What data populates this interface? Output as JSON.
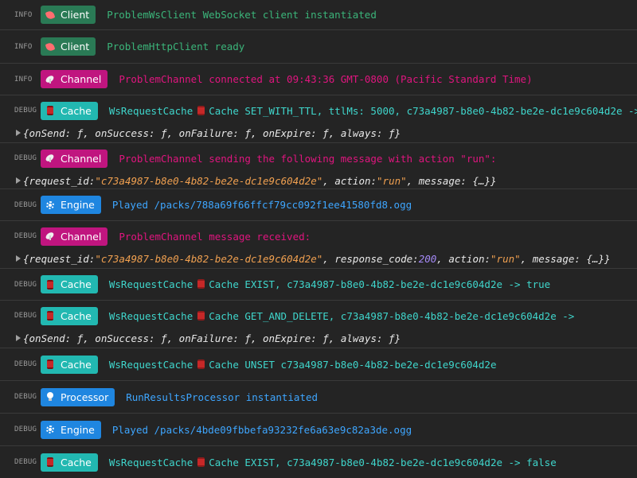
{
  "colors": {
    "background": "#242424",
    "client": "#2a7a55",
    "channel": "#c0157f",
    "cache": "#22b8b1",
    "engine": "#1f86e0",
    "processor": "#1f86e0"
  },
  "entries": [
    {
      "level": "INFO",
      "badge": {
        "label": "Client",
        "icon": "telephone-icon"
      },
      "message": "ProblemWsClient WebSocket client instantiated"
    },
    {
      "level": "INFO",
      "badge": {
        "label": "Client",
        "icon": "telephone-icon"
      },
      "message": "ProblemHttpClient ready"
    },
    {
      "level": "INFO",
      "badge": {
        "label": "Channel",
        "icon": "satellite-dish-icon"
      },
      "message": "ProblemChannel connected at 09:43:36 GMT-0800 (Pacific Standard Time)"
    },
    {
      "level": "DEBUG",
      "badge": {
        "label": "Cache",
        "icon": "cache-can-icon"
      },
      "message_pre": "WsRequestCache",
      "message_post": "Cache SET_WITH_TTL, ttlMs: 5000, c73a4987-b8e0-4b82-be2e-dc1e9c604d2e ->",
      "object": "{onSend: ƒ, onSuccess: ƒ, onFailure: ƒ, onExpire: ƒ, always: ƒ}"
    },
    {
      "level": "DEBUG",
      "badge": {
        "label": "Channel",
        "icon": "satellite-dish-icon"
      },
      "message": "ProblemChannel sending the following message with action \"run\":",
      "object_parts": {
        "k1": "{request_id: ",
        "v1": "\"c73a4987-b8e0-4b82-be2e-dc1e9c604d2e\"",
        "k2": ", action: ",
        "v2": "\"run\"",
        "k3": ", message: {…}}"
      }
    },
    {
      "level": "DEBUG",
      "badge": {
        "label": "Engine",
        "icon": "gear-icon"
      },
      "message": "Played /packs/788a69f66ffcf79cc092f1ee41580fd8.ogg"
    },
    {
      "level": "DEBUG",
      "badge": {
        "label": "Channel",
        "icon": "satellite-dish-icon"
      },
      "message": "ProblemChannel message received:",
      "object_parts": {
        "k1": "{request_id: ",
        "v1": "\"c73a4987-b8e0-4b82-be2e-dc1e9c604d2e\"",
        "k2": ", response_code: ",
        "n1": "200",
        "k3": ", action: ",
        "v2": "\"run\"",
        "k4": ", message: {…}}"
      }
    },
    {
      "level": "DEBUG",
      "badge": {
        "label": "Cache",
        "icon": "cache-can-icon"
      },
      "message_pre": "WsRequestCache",
      "message_post": "Cache EXIST, c73a4987-b8e0-4b82-be2e-dc1e9c604d2e -> true"
    },
    {
      "level": "DEBUG",
      "badge": {
        "label": "Cache",
        "icon": "cache-can-icon"
      },
      "message_pre": "WsRequestCache",
      "message_post": "Cache GET_AND_DELETE, c73a4987-b8e0-4b82-be2e-dc1e9c604d2e ->",
      "object": "{onSend: ƒ, onSuccess: ƒ, onFailure: ƒ, onExpire: ƒ, always: ƒ}"
    },
    {
      "level": "DEBUG",
      "badge": {
        "label": "Cache",
        "icon": "cache-can-icon"
      },
      "message_pre": "WsRequestCache",
      "message_post": "Cache UNSET c73a4987-b8e0-4b82-be2e-dc1e9c604d2e"
    },
    {
      "level": "DEBUG",
      "badge": {
        "label": "Processor",
        "icon": "lightbulb-icon"
      },
      "message": "RunResultsProcessor instantiated"
    },
    {
      "level": "DEBUG",
      "badge": {
        "label": "Engine",
        "icon": "gear-icon"
      },
      "message": "Played /packs/4bde09fbbefa93232fe6a63e9c82a3de.ogg"
    },
    {
      "level": "DEBUG",
      "badge": {
        "label": "Cache",
        "icon": "cache-can-icon"
      },
      "message_pre": "WsRequestCache",
      "message_post": "Cache EXIST, c73a4987-b8e0-4b82-be2e-dc1e9c604d2e -> false"
    }
  ]
}
